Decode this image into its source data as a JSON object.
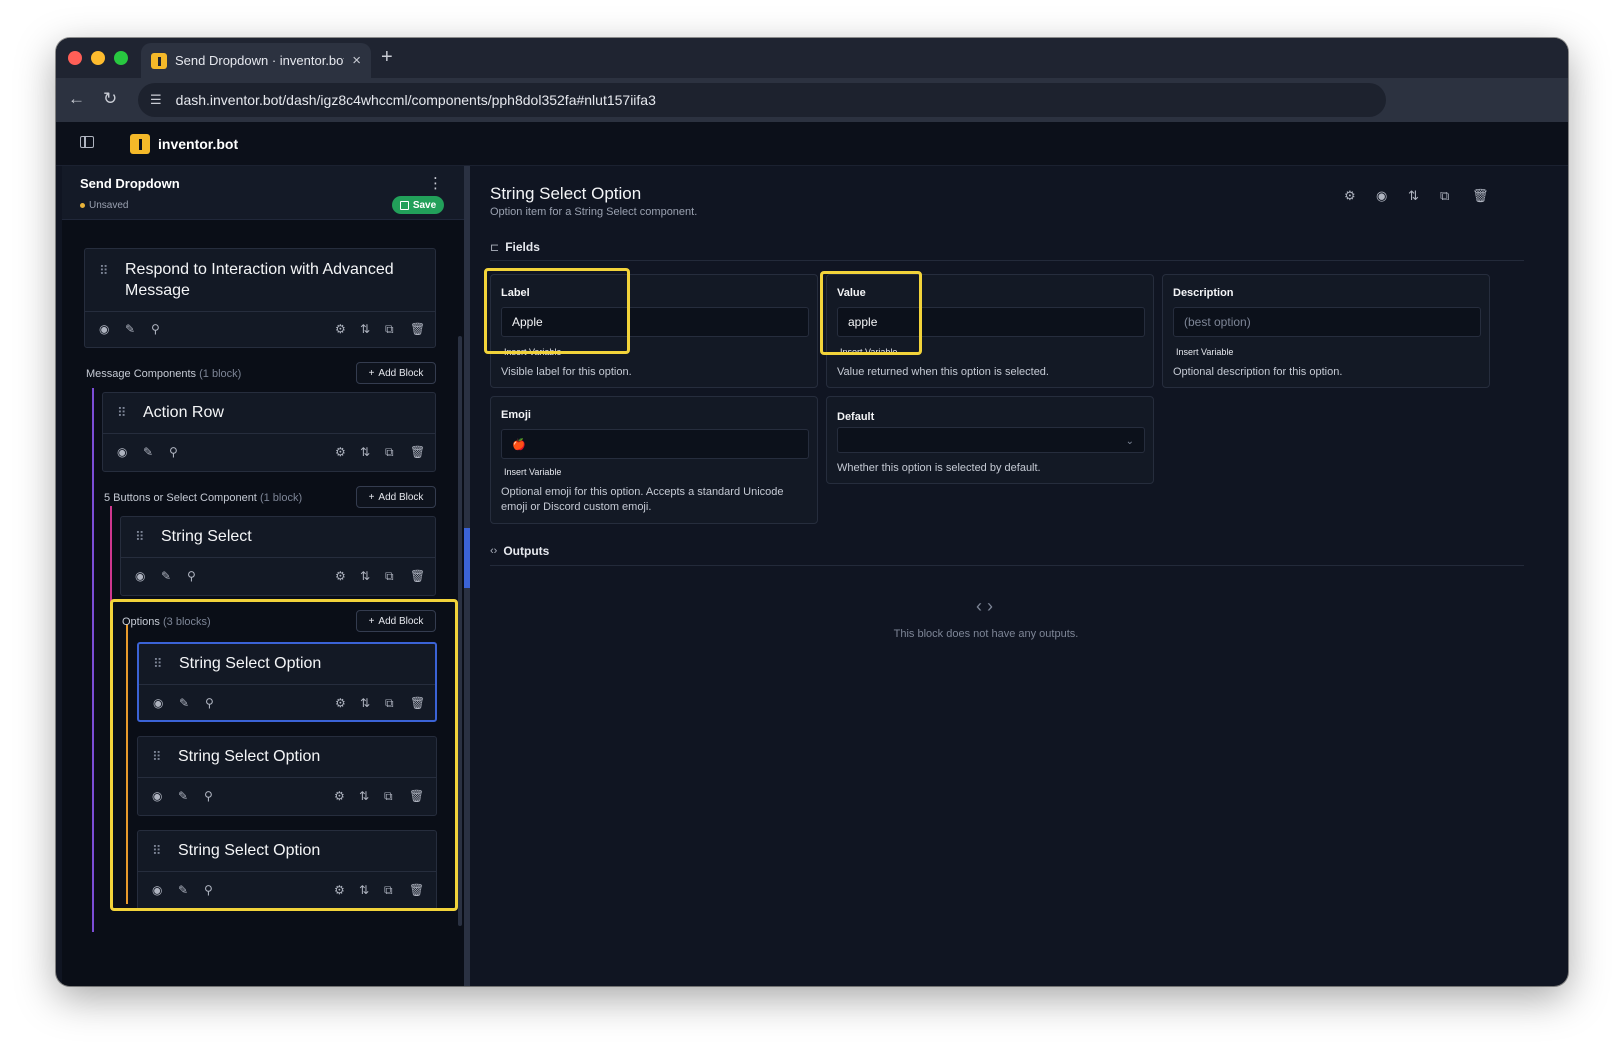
{
  "browser": {
    "tab_title": "Send Dropdown · inventor.bot",
    "tab_close": "×",
    "new_tab": "+",
    "back": "←",
    "reload": "↻",
    "url": "dash.inventor.bot/dash/igz8c4whccml/components/pph8dol352fa#nlut157iifa3"
  },
  "app": {
    "brand": "inventor.bot"
  },
  "left_panel": {
    "title": "Send Dropdown",
    "menu": "⋮",
    "status": "Unsaved",
    "save_label": "Save",
    "respond_block": {
      "title": "Respond to Interaction with Advanced Message"
    },
    "message_components": {
      "label": "Message Components",
      "count": "(1 block)",
      "add_label": "Add Block"
    },
    "action_row": {
      "title": "Action Row"
    },
    "buttons_select": {
      "label": "5 Buttons or Select Component",
      "count": "(1 block)",
      "add_label": "Add Block"
    },
    "string_select": {
      "title": "String Select"
    },
    "options": {
      "label": "Options",
      "count": "(3 blocks)",
      "add_label": "Add Block"
    },
    "option_blocks": [
      {
        "title": "String Select Option"
      },
      {
        "title": "String Select Option"
      },
      {
        "title": "String Select Option"
      }
    ],
    "icons": {
      "drag": "⠿",
      "eye": "◉",
      "edit": "✎",
      "pin": "⚲",
      "settings": "⚙",
      "move": "⇅",
      "copy": "⧉",
      "delete": "🗑",
      "plus": "+"
    }
  },
  "right_panel": {
    "title": "String Select Option",
    "subtitle": "Option item for a String Select component.",
    "fields_label": "Fields",
    "outputs_label": "Outputs",
    "fields": {
      "label": {
        "label": "Label",
        "value": "Apple",
        "insert": "Insert Variable",
        "help": "Visible label for this option."
      },
      "value": {
        "label": "Value",
        "value": "apple",
        "insert": "Insert Variable",
        "help": "Value returned when this option is selected."
      },
      "description": {
        "label": "Description",
        "placeholder": "(best option)",
        "insert": "Insert Variable",
        "help": "Optional description for this option."
      },
      "emoji": {
        "label": "Emoji",
        "value": "🍎",
        "insert": "Insert Variable",
        "help": "Optional emoji for this option. Accepts a standard Unicode emoji or Discord custom emoji."
      },
      "default": {
        "label": "Default",
        "value": "",
        "help": "Whether this option is selected by default."
      }
    },
    "outputs_empty": "This block does not have any outputs.",
    "icons": {
      "fields": "⊏",
      "outputs": "‹›",
      "empty": "‹ ›",
      "chevron": "⌄"
    }
  },
  "colors": {
    "highlight": "#f2d33a",
    "selected": "#3b63d6",
    "save": "#22a05a"
  }
}
